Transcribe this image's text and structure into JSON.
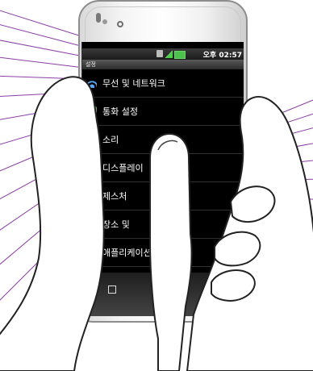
{
  "status_bar": {
    "time": "오후 02:57",
    "icons": [
      "sim-icon",
      "signal-icon",
      "battery-icon"
    ]
  },
  "settings": {
    "title": "설정",
    "items": [
      {
        "label": "무선 및 네트워크",
        "icon": "wifi-icon"
      },
      {
        "label": "통화 설정",
        "icon": "phone-icon"
      },
      {
        "label": "소리",
        "icon": "sound-icon"
      },
      {
        "label": "디스플레이",
        "icon": "display-icon"
      },
      {
        "label": "제스처",
        "icon": "gesture-icon"
      },
      {
        "label": "장소 및",
        "icon": "location-icon"
      },
      {
        "label": "애플리케이션",
        "icon": "apps-icon"
      }
    ]
  },
  "softkeys": {
    "menu_icon": "menu-key-icon"
  },
  "colors": {
    "screen_bg": "#000000",
    "text": "#ffffff",
    "ray_purple": "#8a3fa6",
    "hand_outline": "#222222"
  }
}
